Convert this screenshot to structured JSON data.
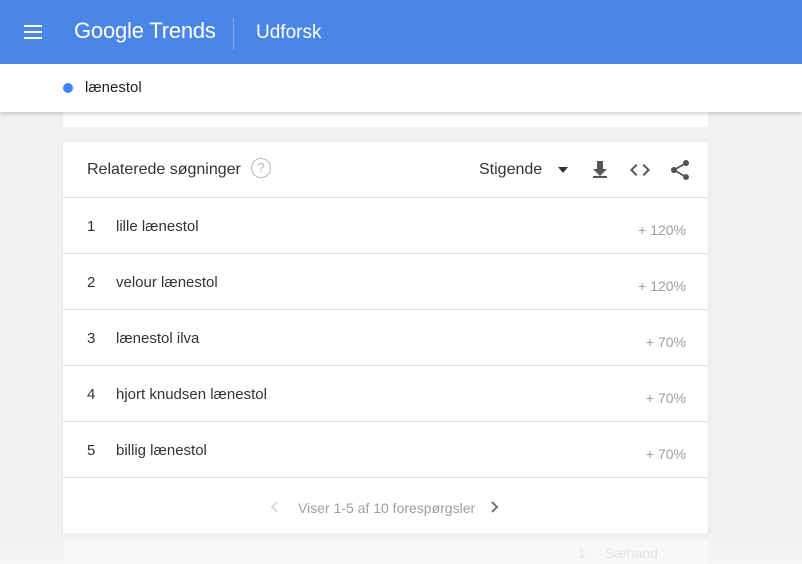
{
  "header": {
    "logo_google": "Google",
    "logo_trends": "Trends",
    "section": "Udforsk"
  },
  "search_term": {
    "label": "lænestol",
    "color": "#4285f4"
  },
  "related_card": {
    "title": "Relaterede søgninger",
    "help_icon": "?",
    "sort_label": "Stigende",
    "rows": [
      {
        "rank": "1",
        "query": "lille lænestol",
        "value": "+ 120%"
      },
      {
        "rank": "2",
        "query": "velour lænestol",
        "value": "+ 120%"
      },
      {
        "rank": "3",
        "query": "lænestol ilva",
        "value": "+ 70%"
      },
      {
        "rank": "4",
        "query": "hjort knudsen lænestol",
        "value": "+ 70%"
      },
      {
        "rank": "5",
        "query": "billig lænestol",
        "value": "+ 70%"
      }
    ],
    "pagination": "Viser 1-5 af 10 forespørgsler"
  },
  "ghost_row": {
    "rank": "1",
    "query": "Sæhand"
  },
  "colors": {
    "topbar": "#4a86e8",
    "accent_dot": "#4285f4"
  }
}
